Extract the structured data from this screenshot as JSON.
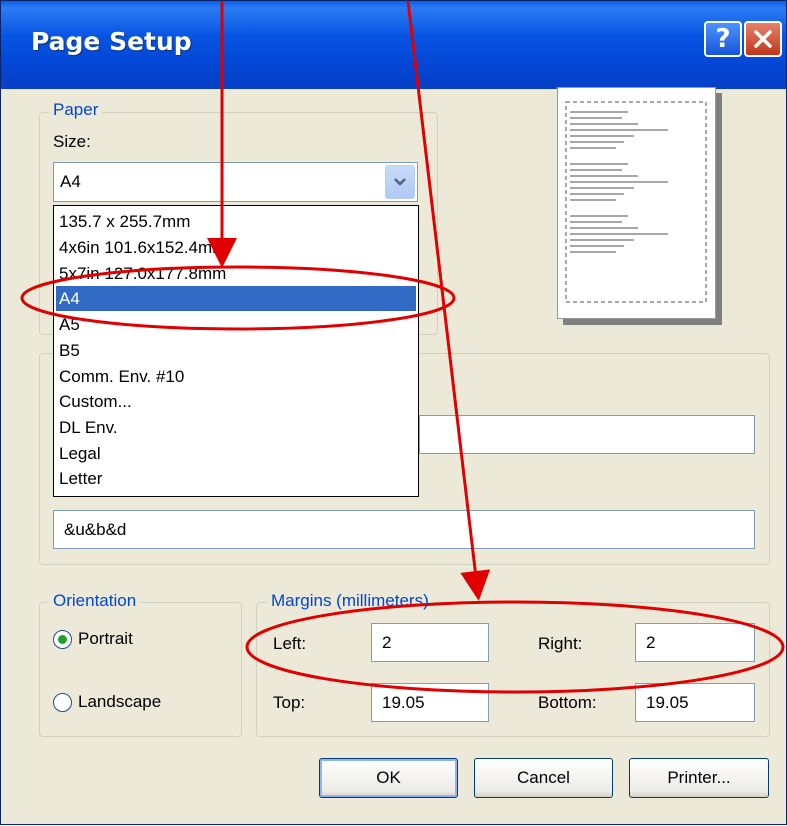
{
  "title": "Page Setup",
  "titlebar": {
    "help_label": "?"
  },
  "paper": {
    "legend": "Paper",
    "size_label": "Size:",
    "size_value": "A4",
    "options": [
      "135.7 x 255.7mm",
      "4x6in 101.6x152.4mm",
      "5x7in 127.0x177.8mm",
      "A4",
      "A5",
      "B5",
      "Comm. Env. #10",
      "Custom...",
      "DL Env.",
      "Legal",
      "Letter"
    ],
    "selected_option": "A4"
  },
  "headers_footers": {
    "footer_value": "&u&b&d"
  },
  "orientation": {
    "legend": "Orientation",
    "portrait_label": "Portrait",
    "landscape_label": "Landscape",
    "selected": "Portrait"
  },
  "margins": {
    "legend": "Margins (millimeters)",
    "left_label": "Left:",
    "left_value": "2",
    "right_label": "Right:",
    "right_value": "2",
    "top_label": "Top:",
    "top_value": "19.05",
    "bottom_label": "Bottom:",
    "bottom_value": "19.05"
  },
  "buttons": {
    "ok": "OK",
    "cancel": "Cancel",
    "printer": "Printer..."
  },
  "colors": {
    "titlebar": "#0854E3",
    "selection": "#316AC5",
    "annotation": "#E00000",
    "legend_text": "#0046D5"
  }
}
